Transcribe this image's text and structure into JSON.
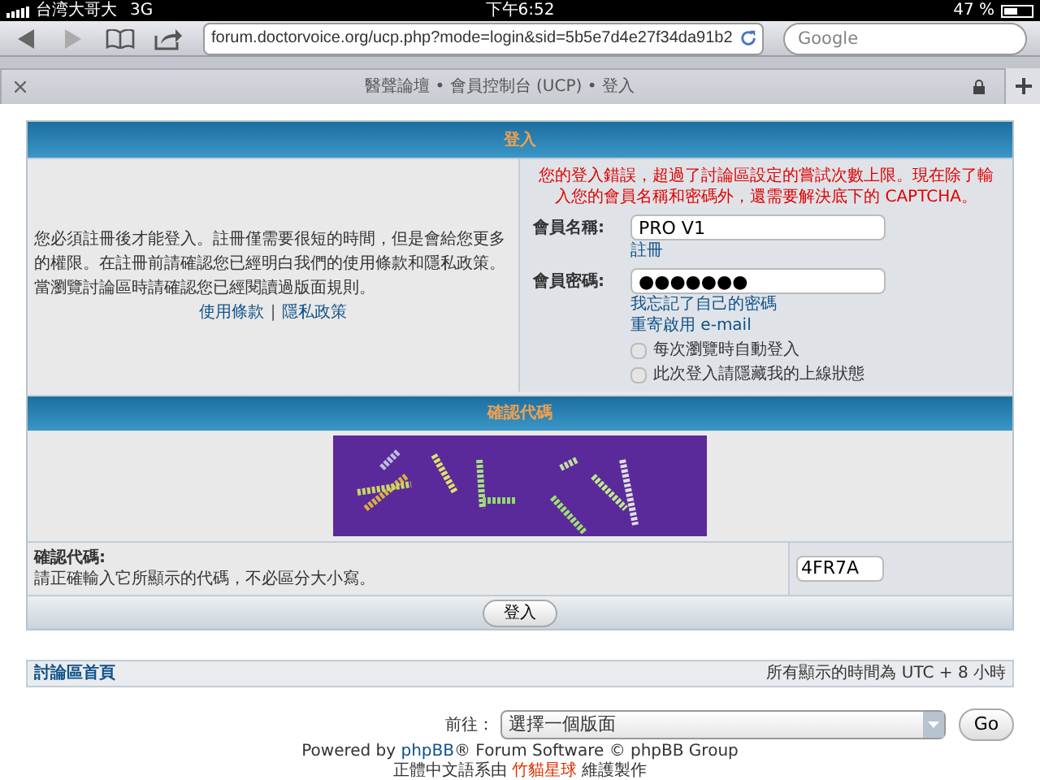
{
  "status_bar": {
    "carrier": "台湾大哥大",
    "network": "3G",
    "time": "下午6:52",
    "battery": "47 %"
  },
  "browser": {
    "url": "forum.doctorvoice.org/ucp.php?mode=login&sid=5b5e7d4e27f34da91b2",
    "search_placeholder": "Google",
    "tab_title": "醫聲論壇 • 會員控制台 (UCP) • 登入"
  },
  "login": {
    "title": "登入",
    "intro": "您必須註冊後才能登入。註冊僅需要很短的時間，但是會給您更多的權限。在註冊前請確認您已經明白我們的使用條款和隱私政策。當瀏覽討論區時請確認您已經閱讀過版面規則。",
    "links": [
      "使用條款",
      "隱私政策"
    ],
    "separator": "|",
    "error": "您的登入錯誤，超過了討論區設定的嘗試次數上限。現在除了輸入您的會員名稱和密碼外，還需要解決底下的 CAPTCHA。",
    "fields": [
      {
        "label": "會員名稱:",
        "value": "PRO V1",
        "links": [
          "註冊"
        ]
      },
      {
        "label": "會員密碼:",
        "value": "●●●●●●●",
        "links": [
          "我忘記了自己的密碼",
          "重寄啟用 e-mail"
        ]
      }
    ],
    "options": [
      {
        "label": "每次瀏覽時自動登入",
        "checked": false
      },
      {
        "label": "此次登入請隱藏我的上線狀態",
        "checked": false
      }
    ]
  },
  "captcha": {
    "title": "確認代碼",
    "label": "確認代碼:",
    "hint": "請正確輸入它所顯示的代碼，不必區分大小寫。",
    "value": "4FR7A",
    "button": "登入"
  },
  "footer": {
    "home_link": "討論區首頁",
    "timezone": "所有顯示的時間為 UTC + 8 小時",
    "jump_label": "前往：",
    "jump_select": "選擇一個版面",
    "go_button": "Go",
    "powered": [
      "Powered by ",
      "phpBB",
      "® Forum Software © phpBB Group"
    ],
    "credit": [
      "正體中文語系由 ",
      "竹貓星球",
      " 維護製作"
    ]
  }
}
